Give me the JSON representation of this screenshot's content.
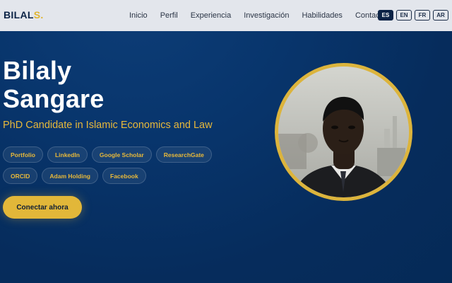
{
  "header": {
    "logo_text": "BILAL",
    "logo_dot": "S.",
    "nav": [
      "Inicio",
      "Perfil",
      "Experiencia",
      "Investigación",
      "Habilidades",
      "Contacto"
    ],
    "languages": [
      {
        "code": "ES",
        "active": true
      },
      {
        "code": "EN",
        "active": false
      },
      {
        "code": "FR",
        "active": false
      },
      {
        "code": "AR",
        "active": false
      }
    ]
  },
  "hero": {
    "name_line1": "Bilaly",
    "name_line2": "Sangare",
    "subtitle": "PhD Candidate in Islamic Economics and Law",
    "links": [
      "Portfolio",
      "LinkedIn",
      "Google Scholar",
      "ResearchGate",
      "ORCID",
      "Adam Holding",
      "Facebook"
    ],
    "cta_label": "Conectar ahora"
  },
  "colors": {
    "accent": "#e2b739",
    "background": "#08356c",
    "navbar": "#e3e6ec",
    "text_dark": "#0b2346"
  },
  "icons": {
    "avatar": "profile-photo"
  }
}
